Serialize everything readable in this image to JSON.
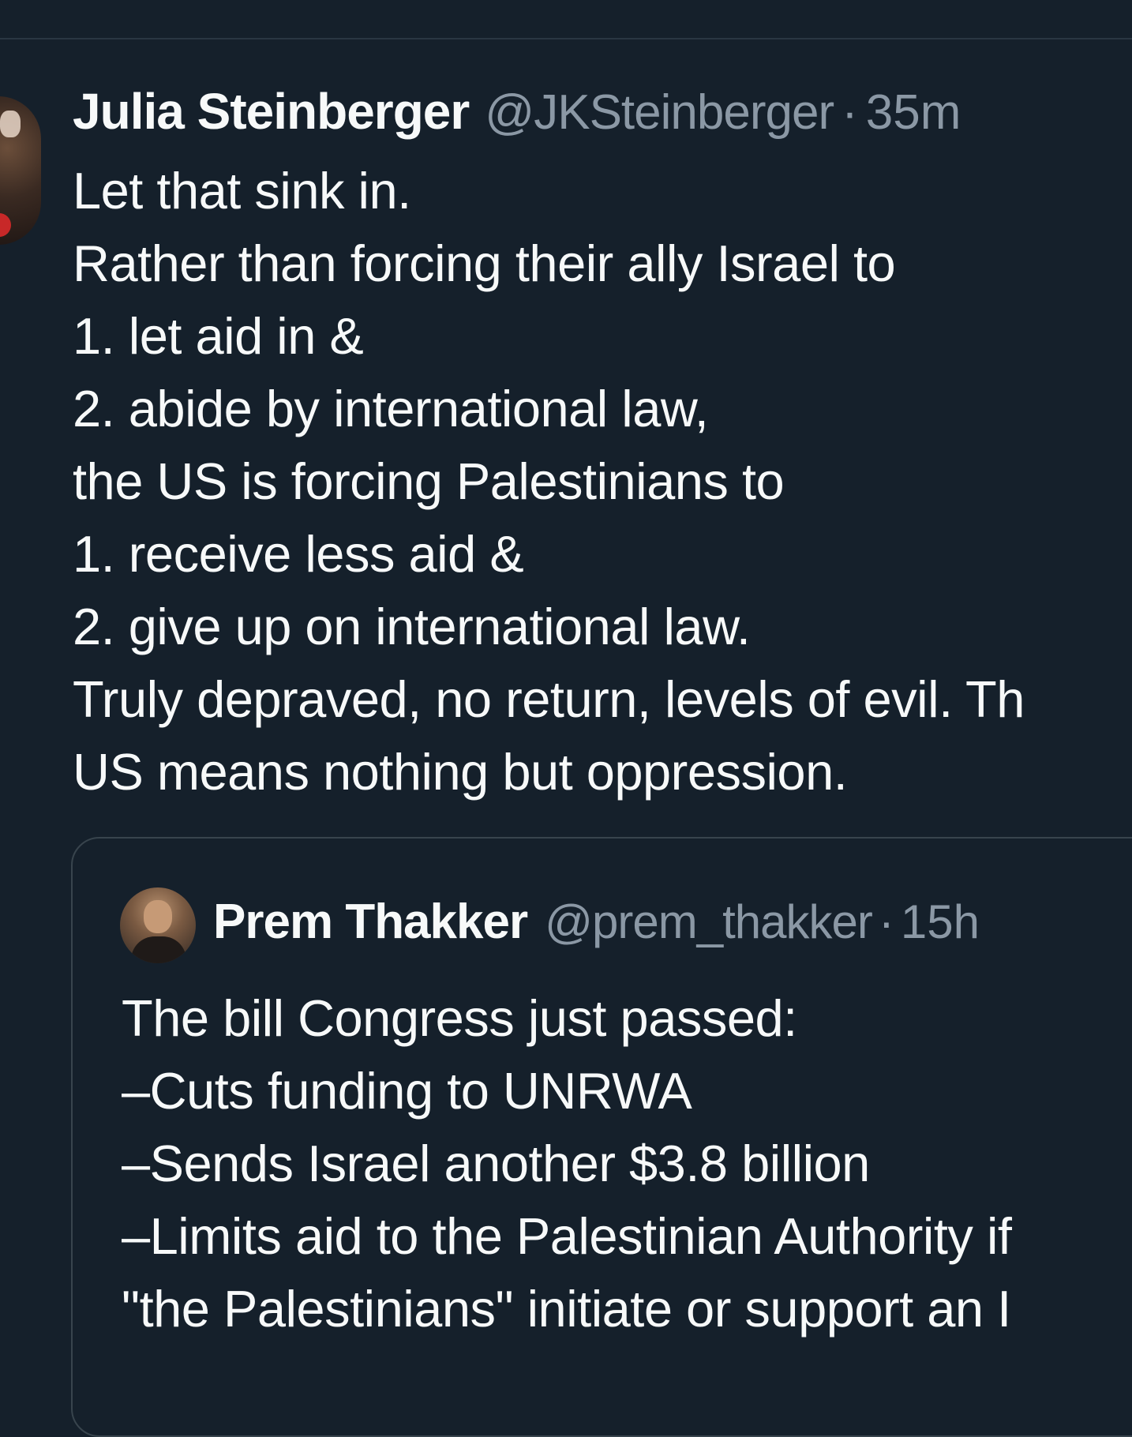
{
  "tweet": {
    "author": {
      "name": "Julia Steinberger",
      "handle": "@JKSteinberger",
      "time": "35m"
    },
    "separator": "·",
    "lines": [
      "Let that sink in.",
      "Rather than forcing their ally Israel to",
      "1. let aid in &",
      "2. abide by international law,",
      "the US is forcing Palestinians to",
      "1. receive less aid &",
      "2. give up on international law.",
      "Truly depraved, no return, levels of evil. Th",
      "US means nothing but oppression."
    ]
  },
  "quote": {
    "author": {
      "name": "Prem Thakker",
      "handle": "@prem_thakker",
      "time": "15h"
    },
    "separator": "·",
    "lines": [
      "The bill Congress just passed:",
      "–Cuts funding to UNRWA",
      "–Sends Israel another $3.8 billion",
      "–Limits aid to the Palestinian Authority if",
      "\"the Palestinians\" initiate or support an I"
    ]
  },
  "colors": {
    "background": "#15202b",
    "text": "#f7f9f9",
    "secondary_text": "#8b98a5",
    "border": "#38444d"
  }
}
